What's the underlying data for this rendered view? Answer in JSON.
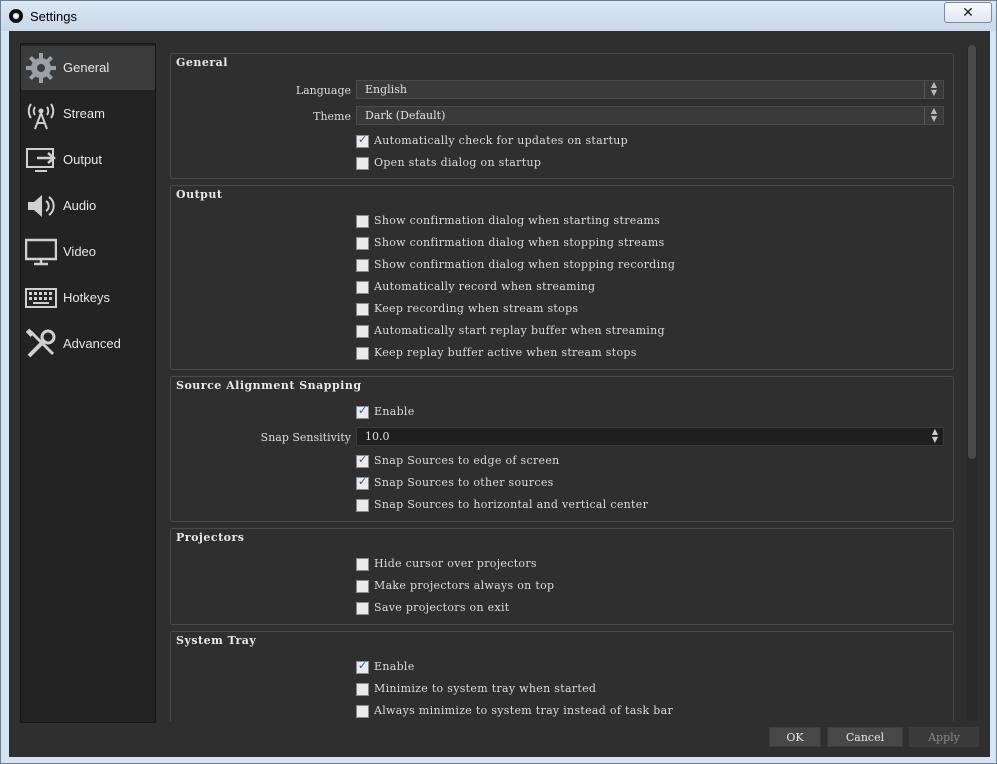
{
  "window": {
    "title": "Settings",
    "close_glyph": "✕"
  },
  "sidebar": {
    "items": [
      {
        "label": "General",
        "icon": "gear-icon",
        "active": true
      },
      {
        "label": "Stream",
        "icon": "broadcast-icon"
      },
      {
        "label": "Output",
        "icon": "output-icon"
      },
      {
        "label": "Audio",
        "icon": "speaker-icon"
      },
      {
        "label": "Video",
        "icon": "monitor-icon"
      },
      {
        "label": "Hotkeys",
        "icon": "keyboard-icon"
      },
      {
        "label": "Advanced",
        "icon": "tools-icon"
      }
    ]
  },
  "general": {
    "title": "General",
    "language_label": "Language",
    "language_value": "English",
    "theme_label": "Theme",
    "theme_value": "Dark (Default)",
    "checks": [
      {
        "label": "Automatically check for updates on startup",
        "checked": true
      },
      {
        "label": "Open stats dialog on startup",
        "checked": false
      }
    ]
  },
  "output": {
    "title": "Output",
    "checks": [
      {
        "label": "Show confirmation dialog when starting streams",
        "checked": false
      },
      {
        "label": "Show confirmation dialog when stopping streams",
        "checked": false
      },
      {
        "label": "Show confirmation dialog when stopping recording",
        "checked": false
      },
      {
        "label": "Automatically record when streaming",
        "checked": false
      },
      {
        "label": "Keep recording when stream stops",
        "checked": false
      },
      {
        "label": "Automatically start replay buffer when streaming",
        "checked": false
      },
      {
        "label": "Keep replay buffer active when stream stops",
        "checked": false
      }
    ]
  },
  "snapping": {
    "title": "Source Alignment Snapping",
    "enable": {
      "label": "Enable",
      "checked": true
    },
    "sensitivity_label": "Snap Sensitivity",
    "sensitivity_value": "10.0",
    "checks": [
      {
        "label": "Snap Sources to edge of screen",
        "checked": true
      },
      {
        "label": "Snap Sources to other sources",
        "checked": true
      },
      {
        "label": "Snap Sources to horizontal and vertical center",
        "checked": false
      }
    ]
  },
  "projectors": {
    "title": "Projectors",
    "checks": [
      {
        "label": "Hide cursor over projectors",
        "checked": false
      },
      {
        "label": "Make projectors always on top",
        "checked": false
      },
      {
        "label": "Save projectors on exit",
        "checked": false
      }
    ]
  },
  "tray": {
    "title": "System Tray",
    "checks": [
      {
        "label": "Enable",
        "checked": true
      },
      {
        "label": "Minimize to system tray when started",
        "checked": false
      },
      {
        "label": "Always minimize to system tray instead of task bar",
        "checked": false
      }
    ]
  },
  "buttons": {
    "ok": "OK",
    "cancel": "Cancel",
    "apply": "Apply"
  },
  "colors": {
    "background": "#2f2f2f",
    "sidebar": "#232323",
    "accent_check": "#1b5fb3"
  }
}
